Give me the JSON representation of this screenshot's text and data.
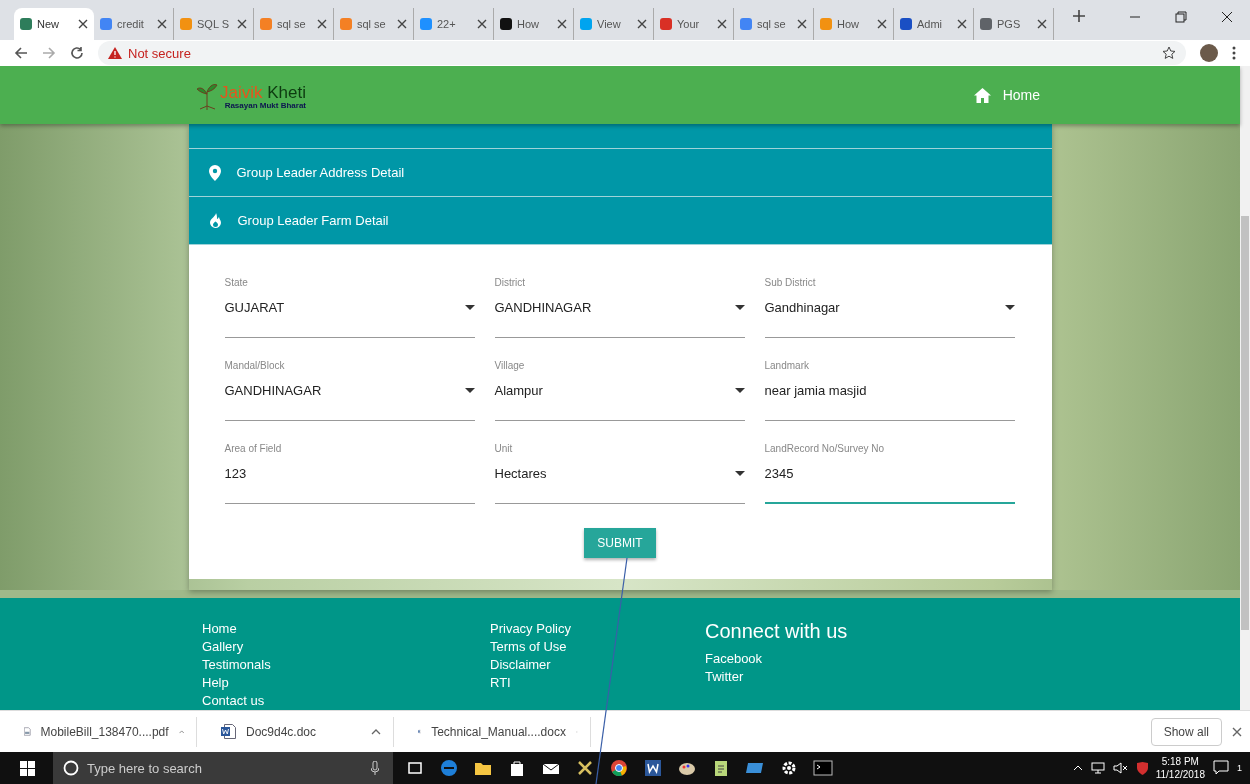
{
  "browser": {
    "tabs": [
      {
        "title": "New",
        "selected": true,
        "color": "#2e7d5b"
      },
      {
        "title": "credit",
        "selected": false,
        "color": "#4285f4"
      },
      {
        "title": "SQL S",
        "selected": false,
        "color": "#f29111"
      },
      {
        "title": "sql se",
        "selected": false,
        "color": "#f48024"
      },
      {
        "title": "sql se",
        "selected": false,
        "color": "#f48024"
      },
      {
        "title": "22+",
        "selected": false,
        "color": "#1e90ff"
      },
      {
        "title": "How",
        "selected": false,
        "color": "#111111"
      },
      {
        "title": "View",
        "selected": false,
        "color": "#00a4ef"
      },
      {
        "title": "Your",
        "selected": false,
        "color": "#d93025"
      },
      {
        "title": "sql se",
        "selected": false,
        "color": "#4285f4"
      },
      {
        "title": "How",
        "selected": false,
        "color": "#f29111"
      },
      {
        "title": "Admi",
        "selected": false,
        "color": "#1a4fc4"
      },
      {
        "title": "PGS",
        "selected": false,
        "color": "#5f6368"
      }
    ],
    "security": "Not secure"
  },
  "site": {
    "logo": {
      "first": "Jaivik",
      "second": "Kheti",
      "tagline": "Rasayan Mukt Bharat"
    },
    "nav": [
      {
        "label": "Home"
      }
    ]
  },
  "accordion": [
    {
      "label": "Group Leader Address Detail",
      "kind": "location"
    },
    {
      "label": "Group Leader Farm Detail",
      "kind": "farm"
    }
  ],
  "form": {
    "fields": [
      {
        "label": "State",
        "value": "GUJARAT",
        "kind": "select",
        "focused": false
      },
      {
        "label": "District",
        "value": "GANDHINAGAR",
        "kind": "select",
        "focused": false
      },
      {
        "label": "Sub District",
        "value": "Gandhinagar",
        "kind": "select",
        "focused": false
      },
      {
        "label": "Mandal/Block",
        "value": "GANDHINAGAR",
        "kind": "select",
        "focused": false
      },
      {
        "label": "Village",
        "value": "Alampur",
        "kind": "select",
        "focused": false
      },
      {
        "label": "Landmark",
        "value": "near jamia masjid",
        "kind": "text",
        "focused": false
      },
      {
        "label": "Area of Field",
        "value": "123",
        "kind": "text",
        "focused": false
      },
      {
        "label": "Unit",
        "value": "Hectares",
        "kind": "select",
        "focused": false
      },
      {
        "label": "LandRecord No/Survey No",
        "value": "2345",
        "kind": "text",
        "focused": true
      }
    ],
    "submit": "SUBMIT"
  },
  "footer": {
    "links_1": [
      "Home",
      "Gallery",
      "Testimonals",
      "Help",
      "Contact us"
    ],
    "links_2": [
      "Privacy Policy",
      "Terms of Use",
      "Disclaimer",
      "RTI"
    ],
    "connect": {
      "heading": "Connect with us",
      "links": [
        "Facebook",
        "Twitter"
      ]
    }
  },
  "downloads": {
    "items": [
      {
        "name": "MobileBill_138470....pdf",
        "kind": "pdf"
      },
      {
        "name": "Doc9d4c.doc",
        "kind": "word"
      },
      {
        "name": "Technical_Manual....docx",
        "kind": "word"
      }
    ],
    "show_all": "Show all"
  },
  "taskbar": {
    "search_placeholder": "Type here to search",
    "time": "5:18 PM",
    "date": "11/12/2018",
    "notifications": "1"
  }
}
